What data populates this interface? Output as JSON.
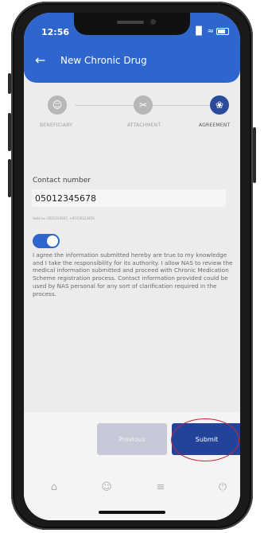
{
  "status_bar": {
    "time": "12:56",
    "signal": "▐▌",
    "wifi": "≈"
  },
  "header": {
    "back_icon": "←",
    "title": "New Chronic Drug"
  },
  "steps": [
    {
      "label": "BENEFICIARY",
      "icon": "☺",
      "active": false
    },
    {
      "label": "ATTACHMENT",
      "icon": "✂",
      "active": false
    },
    {
      "label": "AGREEMENT",
      "icon": "❀",
      "active": true
    }
  ],
  "form": {
    "contact_label": "Contact number",
    "contact_value": "05012345678",
    "contact_hint": "Valid ex: 0501234567, +97150123456",
    "toggle_on": true,
    "agreement_text": "I agree the information submitted hereby are true to my knowledge and I take the responsibility for its authority. I allow NAS to review the medical information submitted and proceed with Chronic Medication Scheme registration process. Contact information provided could be used by NAS personal for any sort of clarification required in the process."
  },
  "buttons": {
    "previous": "Previous",
    "submit": "Submit"
  },
  "tabbar": {
    "home_icon": "⌂",
    "profile_icon": "☺",
    "settings_icon": "≡",
    "power_icon": "⏻"
  },
  "colors": {
    "primary": "#2f66cd",
    "submit": "#23439a",
    "annotation": "#c0283a"
  }
}
